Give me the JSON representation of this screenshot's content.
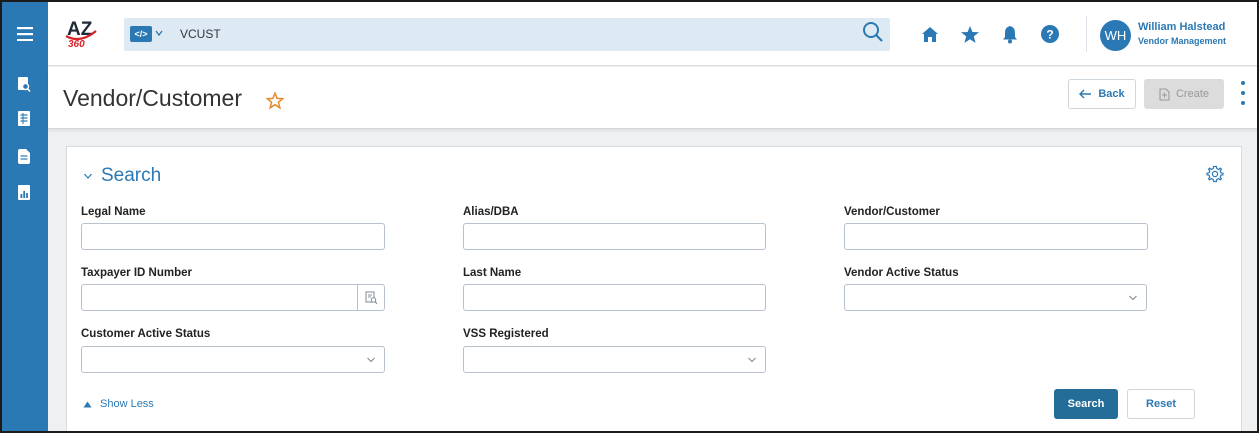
{
  "topbar": {
    "logo_text": "AZ 360",
    "command_chip": "</>",
    "command_value": "VCUST",
    "user_initials": "WH",
    "user_name": "William Halstead",
    "user_role": "Vendor Management"
  },
  "rail": {
    "icons": [
      "menu-icon",
      "search-document-icon",
      "ledger-icon",
      "document-icon",
      "report-icon"
    ]
  },
  "page": {
    "title": "Vendor/Customer",
    "back_label": "Back",
    "create_label": "Create"
  },
  "search": {
    "title": "Search",
    "fields": {
      "legal_name": {
        "label": "Legal Name",
        "value": ""
      },
      "alias_dba": {
        "label": "Alias/DBA",
        "value": ""
      },
      "vendor_customer": {
        "label": "Vendor/Customer",
        "value": ""
      },
      "taxpayer_id": {
        "label": "Taxpayer ID Number",
        "value": ""
      },
      "last_name": {
        "label": "Last Name",
        "value": ""
      },
      "vendor_active_status": {
        "label": "Vendor Active Status",
        "value": ""
      },
      "customer_active_status": {
        "label": "Customer Active Status",
        "value": ""
      },
      "vss_registered": {
        "label": "VSS Registered",
        "value": ""
      }
    },
    "show_less_label": "Show Less",
    "search_button": "Search",
    "reset_button": "Reset"
  },
  "colors": {
    "brand_blue": "#2b79b4",
    "search_button": "#246d99",
    "favorite_star": "#e8892b",
    "logo_red": "#d8232a"
  }
}
